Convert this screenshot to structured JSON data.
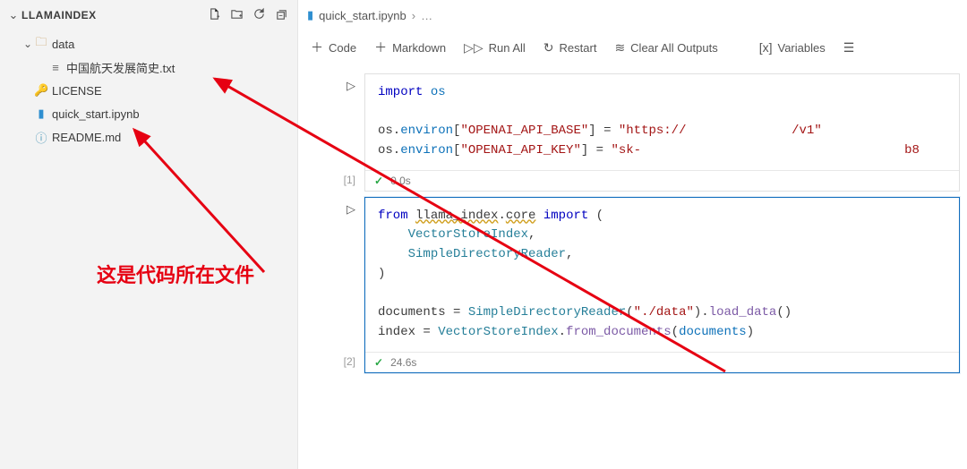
{
  "sidebar": {
    "title": "LLAMAINDEX",
    "actions": [
      "new-file",
      "new-folder",
      "refresh",
      "collapse"
    ],
    "items": [
      {
        "label": "data",
        "kind": "folder",
        "expanded": true,
        "depth": 0
      },
      {
        "label": "中国航天发展简史.txt",
        "kind": "txt",
        "depth": 1
      },
      {
        "label": "LICENSE",
        "kind": "key",
        "depth": 0
      },
      {
        "label": "quick_start.ipynb",
        "kind": "nb",
        "depth": 0
      },
      {
        "label": "README.md",
        "kind": "md",
        "depth": 0
      }
    ]
  },
  "tab": {
    "file": "quick_start.ipynb",
    "breadcrumb": "…"
  },
  "toolbar": {
    "code": "Code",
    "markdown": "Markdown",
    "run_all": "Run All",
    "restart": "Restart",
    "clear": "Clear All Outputs",
    "variables": "Variables"
  },
  "cells": [
    {
      "index_label": "[1]",
      "status": "0.0s",
      "lines": [
        [
          {
            "t": "import",
            "c": "kw"
          },
          {
            "t": " "
          },
          {
            "t": "os",
            "c": "var"
          }
        ],
        [
          {
            "t": ""
          }
        ],
        [
          {
            "t": "os"
          },
          {
            "t": "."
          },
          {
            "t": "environ",
            "c": "attr"
          },
          {
            "t": "["
          },
          {
            "t": "\"OPENAI_API_BASE\"",
            "c": "str"
          },
          {
            "t": "] = "
          },
          {
            "t": "\"https://",
            "c": "str"
          },
          {
            "t": "              ",
            "c": "blur"
          },
          {
            "t": "/v1\"",
            "c": "str"
          }
        ],
        [
          {
            "t": "os"
          },
          {
            "t": "."
          },
          {
            "t": "environ",
            "c": "attr"
          },
          {
            "t": "["
          },
          {
            "t": "\"OPENAI_API_KEY\"",
            "c": "str"
          },
          {
            "t": "] = "
          },
          {
            "t": "\"sk-",
            "c": "str"
          },
          {
            "t": "                                   ",
            "c": "blur"
          },
          {
            "t": "b8",
            "c": "str"
          }
        ]
      ]
    },
    {
      "index_label": "[2]",
      "status": "24.6s",
      "focused": true,
      "lines": [
        [
          {
            "t": "from",
            "c": "kw"
          },
          {
            "t": " "
          },
          {
            "t": "llama_index",
            "c": "wavy"
          },
          {
            "t": "."
          },
          {
            "t": "core",
            "c": "wavy"
          },
          {
            "t": " "
          },
          {
            "t": "import",
            "c": "kw"
          },
          {
            "t": " ("
          }
        ],
        [
          {
            "t": "    "
          },
          {
            "t": "VectorStoreIndex",
            "c": "cls"
          },
          {
            "t": ","
          }
        ],
        [
          {
            "t": "    "
          },
          {
            "t": "SimpleDirectoryReader",
            "c": "cls"
          },
          {
            "t": ","
          }
        ],
        [
          {
            "t": ")"
          }
        ],
        [
          {
            "t": ""
          }
        ],
        [
          {
            "t": "documents = "
          },
          {
            "t": "SimpleDirectoryReader",
            "c": "cls"
          },
          {
            "t": "("
          },
          {
            "t": "\"./data\"",
            "c": "str"
          },
          {
            "t": ")."
          },
          {
            "t": "load_data",
            "c": "fn"
          },
          {
            "t": "()"
          }
        ],
        [
          {
            "t": "index = "
          },
          {
            "t": "VectorStoreIndex",
            "c": "cls"
          },
          {
            "t": "."
          },
          {
            "t": "from_documents",
            "c": "fn"
          },
          {
            "t": "("
          },
          {
            "t": "documents",
            "c": "var"
          },
          {
            "t": ")"
          }
        ]
      ]
    }
  ],
  "annotation": "这是代码所在文件"
}
